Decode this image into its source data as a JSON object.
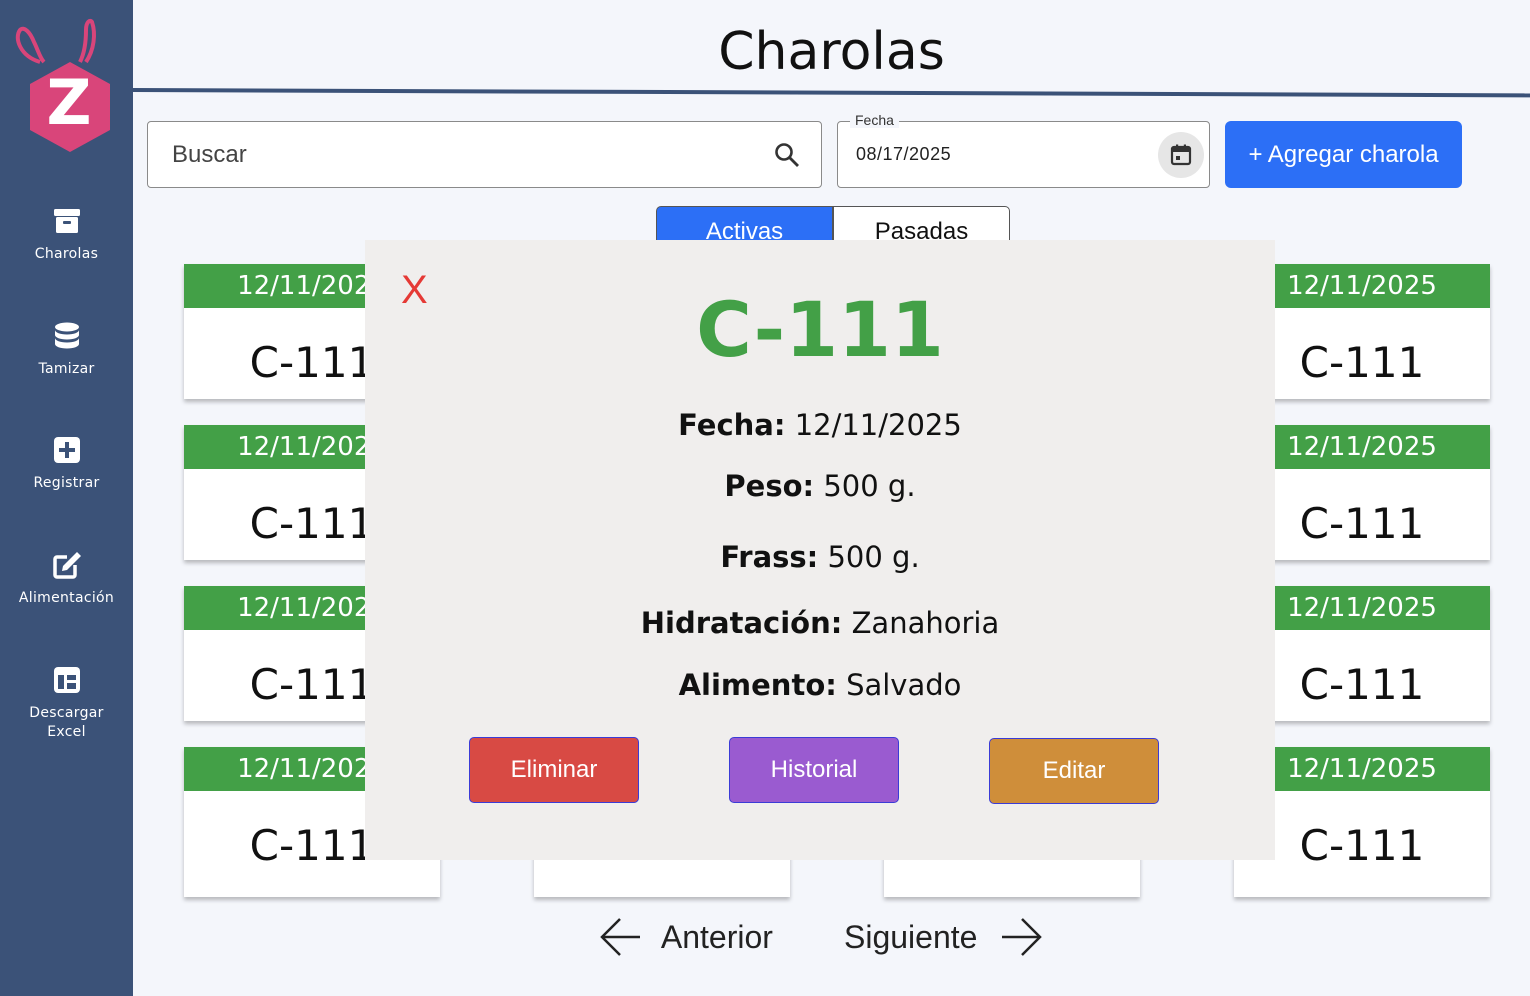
{
  "app": {
    "logo_letter": "Z"
  },
  "sidebar": {
    "items": [
      {
        "label": "Charolas",
        "icon": "tray-archive-icon"
      },
      {
        "label": "Tamizar",
        "icon": "database-icon"
      },
      {
        "label": "Registrar",
        "icon": "plus-square-icon"
      },
      {
        "label": "Alimentación",
        "icon": "edit-icon"
      },
      {
        "label": "Descargar\nExcel",
        "icon": "table-icon"
      }
    ]
  },
  "header": {
    "title": "Charolas"
  },
  "toolbar": {
    "search_placeholder": "Buscar",
    "date_label": "Fecha",
    "date_value": "08/17/2025",
    "add_label": "+ Agregar charola"
  },
  "tabs": {
    "active": "Activas",
    "past": "Pasadas"
  },
  "cards": {
    "col1": [
      {
        "date": "12/11/2025",
        "code": "C-111"
      },
      {
        "date": "12/11/2025",
        "code": "C-111"
      },
      {
        "date": "12/11/2025",
        "code": "C-111"
      },
      {
        "date": "12/11/2025",
        "code": "C-111"
      }
    ],
    "col4": [
      {
        "date": "12/11/2025",
        "code": "C-111"
      },
      {
        "date": "12/11/2025",
        "code": "C-111"
      },
      {
        "date": "12/11/2025",
        "code": "C-111"
      },
      {
        "date": "12/11/2025",
        "code": "C-111"
      }
    ]
  },
  "modal": {
    "close": "X",
    "title": "C-111",
    "fecha_label": "Fecha:",
    "fecha_value": "12/11/2025",
    "peso_label": "Peso:",
    "peso_value": "500 g.",
    "frass_label": "Frass:",
    "frass_value": "500 g.",
    "hidratacion_label": "Hidratación:",
    "hidratacion_value": "Zanahoria",
    "alimento_label": "Alimento:",
    "alimento_value": "Salvado",
    "delete_label": "Eliminar",
    "history_label": "Historial",
    "edit_label": "Editar"
  },
  "pager": {
    "prev": "Anterior",
    "next": "Siguiente"
  },
  "colors": {
    "sidebar": "#3b5278",
    "green": "#43a047",
    "blue": "#2c6ff6",
    "delete": "#d84a44",
    "history": "#9a5bd0",
    "edit": "#cf8e3a",
    "close": "#e53935"
  }
}
